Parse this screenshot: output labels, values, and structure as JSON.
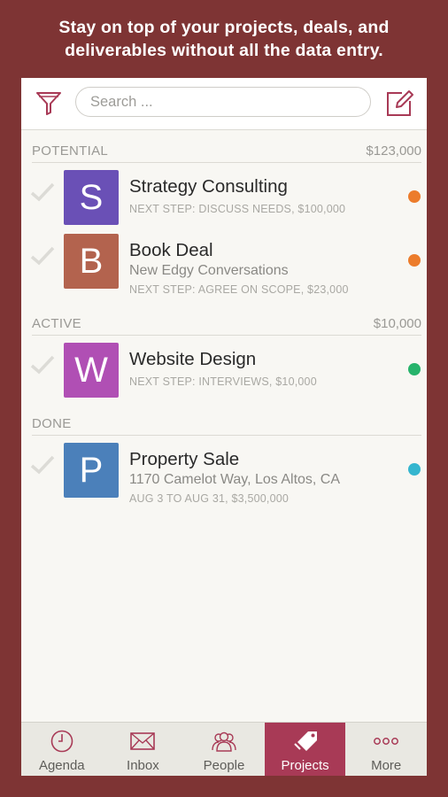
{
  "tagline": {
    "line1": "Stay on top of your projects, deals, and",
    "line2": "deliverables without all the data entry."
  },
  "search": {
    "placeholder": "Search ..."
  },
  "icons": {
    "filter": "funnel-icon",
    "compose": "compose-icon"
  },
  "colors": {
    "accent": "#a83a56",
    "background": "#7e3434"
  },
  "sections": [
    {
      "name": "POTENTIAL",
      "total": "$123,000",
      "items": [
        {
          "letter": "S",
          "title": "Strategy Consulting",
          "subtitle": "",
          "next": "NEXT STEP: DISCUSS NEEDS, $100,000",
          "avatar_color": "#6a50b6",
          "dot_color": "#ec7c2b"
        },
        {
          "letter": "B",
          "title": "Book Deal",
          "subtitle": "New Edgy Conversations",
          "next": "NEXT STEP: AGREE ON SCOPE, $23,000",
          "avatar_color": "#b3634e",
          "dot_color": "#ec7c2b"
        }
      ]
    },
    {
      "name": "ACTIVE",
      "total": "$10,000",
      "items": [
        {
          "letter": "W",
          "title": "Website Design",
          "subtitle": "",
          "next": "NEXT STEP: INTERVIEWS, $10,000",
          "avatar_color": "#b04fb4",
          "dot_color": "#27b36b"
        }
      ]
    },
    {
      "name": "DONE",
      "total": "",
      "items": [
        {
          "letter": "P",
          "title": "Property Sale",
          "subtitle": "1170 Camelot Way, Los Altos, CA",
          "next": "AUG 3 TO AUG 31, $3,500,000",
          "avatar_color": "#4b80ba",
          "dot_color": "#35b6cf"
        }
      ]
    }
  ],
  "tabs": [
    {
      "label": "Agenda",
      "icon": "clock-icon",
      "active": false
    },
    {
      "label": "Inbox",
      "icon": "envelope-icon",
      "active": false
    },
    {
      "label": "People",
      "icon": "people-icon",
      "active": false
    },
    {
      "label": "Projects",
      "icon": "tag-icon",
      "active": true
    },
    {
      "label": "More",
      "icon": "more-dots-icon",
      "active": false
    }
  ]
}
